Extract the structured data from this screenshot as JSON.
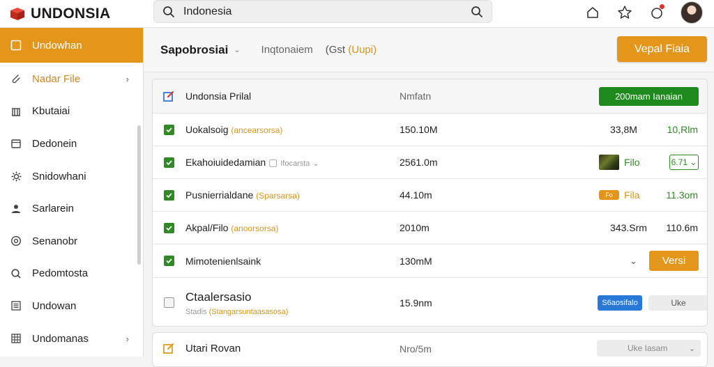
{
  "app": {
    "name": "UNDONSIA",
    "brand_color": "#e3961a",
    "logo_color": "#d63a2a"
  },
  "search": {
    "value": "Indonesia",
    "placeholder": "Indonesia"
  },
  "top_icons": [
    "home-icon",
    "star-icon",
    "notification-icon",
    "avatar"
  ],
  "sidebar": {
    "items": [
      {
        "label": "Undowhan",
        "icon": "square-icon",
        "state": "active"
      },
      {
        "label": "Nadar File",
        "icon": "paperclip-icon",
        "state": "accent",
        "has_chevron": true
      },
      {
        "label": "Kbutaiai",
        "icon": "building-icon"
      },
      {
        "label": "Dedonein",
        "icon": "calendar-icon"
      },
      {
        "label": "Snidowhani",
        "icon": "gear-icon"
      },
      {
        "label": "Sarlarein",
        "icon": "user-icon"
      },
      {
        "label": "Senanobr",
        "icon": "dial-icon"
      },
      {
        "label": "Pedomtosta",
        "icon": "pin-icon"
      },
      {
        "label": "Undowan",
        "icon": "list-icon"
      },
      {
        "label": "Undomanas",
        "icon": "grid-icon",
        "has_chevron": true
      }
    ]
  },
  "header": {
    "title": "Sapobrosiai",
    "subtitle": "Inqtonaiem",
    "extra_prefix": "(Gst",
    "extra_highlight": "(Uupi)",
    "primary_button": "Vepal Fiaia"
  },
  "files": {
    "header": {
      "name": "Undonsia Prilal",
      "size": "Nmfatn",
      "button": "200mam Ianaian"
    },
    "rows": [
      {
        "name": "Uokalsoig",
        "tag": "(ancearsorsa)",
        "size": "150.10M",
        "value1": "33,8M",
        "value2": "10,Rlm",
        "value2_color": "#2f8a24"
      },
      {
        "name": "Ekahoiuidedamian",
        "tag": "Ifocarsta",
        "size": "2561.0m",
        "file_label": "Filo",
        "badge": "6.71"
      },
      {
        "name": "Pusnierrialdane",
        "tag": "(Sparsarsa)",
        "size": "44.10m",
        "chip": "Fo",
        "file_label": "Fila",
        "value2": "11.3om",
        "value2_color": "#2f8a24"
      },
      {
        "name": "Akpal/Filo",
        "tag": "(anoorsorsa)",
        "size": "2010m",
        "value1": "343.Srm",
        "value2": "110.6m",
        "value2_color": "#222222"
      },
      {
        "name": "Mimotenienlsaink",
        "size": "130mM",
        "button": "Versi"
      }
    ],
    "tall_row": {
      "name": "Ctaalersasio",
      "sub_prefix": "Stadis",
      "sub_highlight": "(Stangarsuntaasasosa)",
      "size": "15.9nm",
      "blue_button": "S6aosifalo",
      "grey_button": "Uke"
    }
  },
  "bottom_panel": {
    "name": "Utari Rovan",
    "size": "Nro/5m",
    "select_value": "Uke Iasam"
  }
}
